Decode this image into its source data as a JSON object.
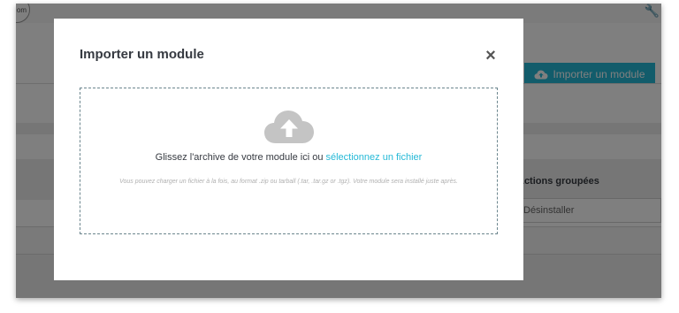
{
  "page": {
    "avatar_text": "om",
    "import_button_label": "Importer un module",
    "bulk_actions_label": "Actions groupées",
    "bulk_select_value": "Désinstaller"
  },
  "modal": {
    "title": "Importer un module",
    "close_symbol": "×",
    "drop_text": "Glissez l'archive de votre module ici ou",
    "drop_link": "sélectionnez un fichier",
    "hint": "Vous pouvez charger un fichier à la fois, au format .zip ou tarball (.tar, .tar.gz or .tgz). Votre module sera installé juste après."
  },
  "icons": {
    "upload_cloud": "cloud-upload-icon",
    "settings": "wrench-icon"
  },
  "colors": {
    "accent": "#25b9d7",
    "overlay": "rgba(0,0,0,0.5)",
    "dropzone_border": "#6c868e"
  }
}
